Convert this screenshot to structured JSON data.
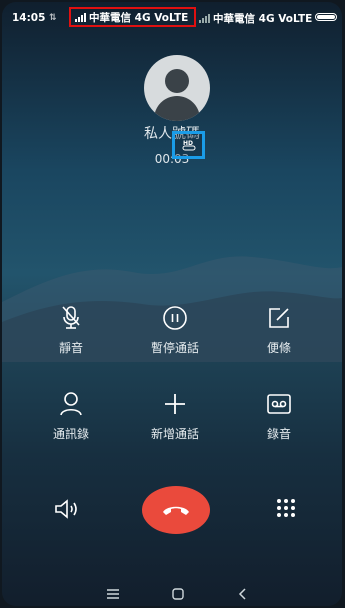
{
  "status_bar": {
    "time": "14:05",
    "sim1_carrier": "中華電信 4G VoLTE",
    "sim2_carrier": "中華電信 4G VoLTE",
    "battery_icon": "battery-icon"
  },
  "call": {
    "caller_name": "私人號碼",
    "duration": "00:03",
    "hd_icon": "hd-voice-icon"
  },
  "actions": [
    {
      "label": "靜音",
      "icon": "mute-mic-icon"
    },
    {
      "label": "暫停通話",
      "icon": "pause-icon"
    },
    {
      "label": "便條",
      "icon": "note-icon"
    },
    {
      "label": "通訊錄",
      "icon": "contacts-icon"
    },
    {
      "label": "新增通話",
      "icon": "add-call-icon"
    },
    {
      "label": "錄音",
      "icon": "record-icon"
    }
  ],
  "controls": {
    "speaker_icon": "speaker-icon",
    "end_call_icon": "end-call-icon",
    "keypad_icon": "keypad-icon"
  },
  "nav": {
    "menu_icon": "menu-icon",
    "home_icon": "home-icon",
    "back_icon": "back-icon"
  },
  "colors": {
    "end_call": "#ea4a3c",
    "highlight_red": "#e01010",
    "highlight_blue": "#1a9ce8"
  }
}
